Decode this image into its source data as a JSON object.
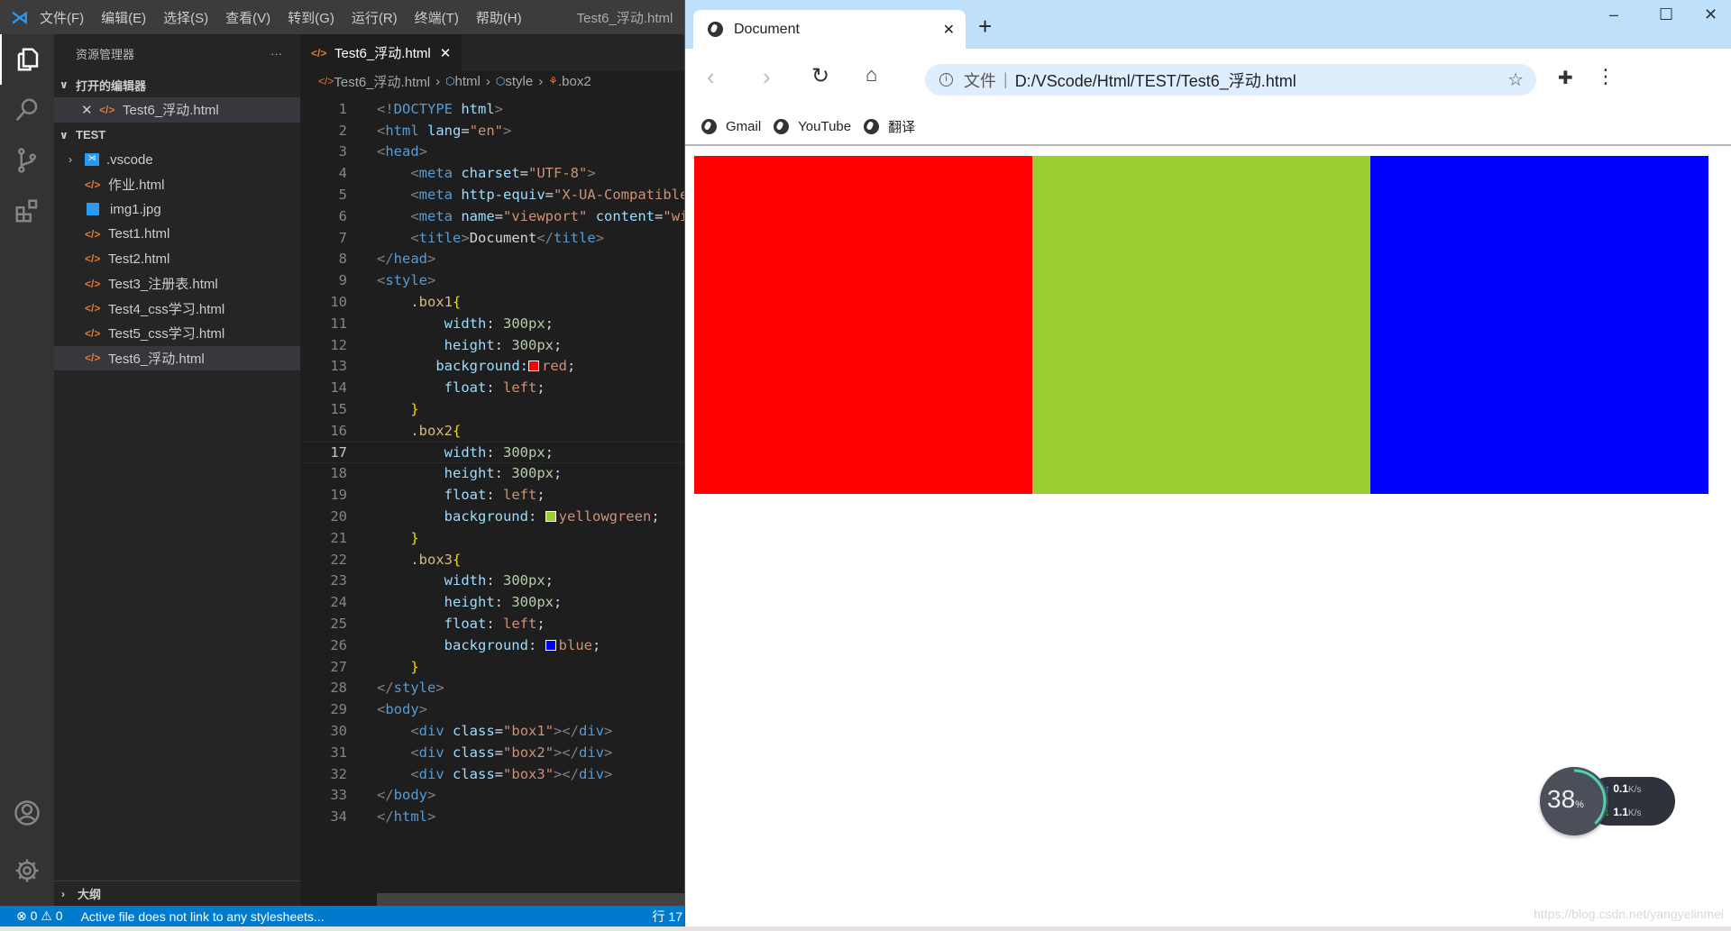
{
  "vscode": {
    "menu": [
      "文件(F)",
      "编辑(E)",
      "选择(S)",
      "查看(V)",
      "转到(G)",
      "运行(R)",
      "终端(T)",
      "帮助(H)"
    ],
    "window_title": "Test6_浮动.html",
    "sidebar": {
      "title": "资源管理器",
      "more": "···",
      "open_editors_label": "打开的编辑器",
      "open_editors": [
        {
          "name": "Test6_浮动.html",
          "close": "✕"
        }
      ],
      "folder_label": "TEST",
      "files": [
        {
          "name": ".vscode",
          "type": "folder"
        },
        {
          "name": "作业.html",
          "type": "html"
        },
        {
          "name": "img1.jpg",
          "type": "image"
        },
        {
          "name": "Test1.html",
          "type": "html"
        },
        {
          "name": "Test2.html",
          "type": "html"
        },
        {
          "name": "Test3_注册表.html",
          "type": "html"
        },
        {
          "name": "Test4_css学习.html",
          "type": "html"
        },
        {
          "name": "Test5_css学习.html",
          "type": "html"
        },
        {
          "name": "Test6_浮动.html",
          "type": "html",
          "selected": true
        }
      ],
      "outline_label": "大纲"
    },
    "tab": {
      "label": "Test6_浮动.html",
      "close": "✕"
    },
    "breadcrumb": [
      "Test6_浮动.html",
      "html",
      "style",
      ".box2"
    ],
    "current_line": 17,
    "code": [
      [
        [
          "p",
          "<!"
        ],
        [
          "tag",
          "DOCTYPE"
        ],
        [
          "txt",
          " "
        ],
        [
          "at",
          "html"
        ],
        [
          "p",
          ">"
        ]
      ],
      [
        [
          "p",
          "<"
        ],
        [
          "tag",
          "html"
        ],
        [
          "txt",
          " "
        ],
        [
          "at",
          "lang"
        ],
        [
          "txt",
          "="
        ],
        [
          "s",
          "\"en\""
        ],
        [
          "p",
          ">"
        ]
      ],
      [
        [
          "p",
          "<"
        ],
        [
          "tag",
          "head"
        ],
        [
          "p",
          ">"
        ]
      ],
      [
        [
          "txt",
          "    "
        ],
        [
          "p",
          "<"
        ],
        [
          "tag",
          "meta"
        ],
        [
          "txt",
          " "
        ],
        [
          "at",
          "charset"
        ],
        [
          "txt",
          "="
        ],
        [
          "s",
          "\"UTF-8\""
        ],
        [
          "p",
          ">"
        ]
      ],
      [
        [
          "txt",
          "    "
        ],
        [
          "p",
          "<"
        ],
        [
          "tag",
          "meta"
        ],
        [
          "txt",
          " "
        ],
        [
          "at",
          "http-equiv"
        ],
        [
          "txt",
          "="
        ],
        [
          "s",
          "\"X-UA-Compatible\""
        ]
      ],
      [
        [
          "txt",
          "    "
        ],
        [
          "p",
          "<"
        ],
        [
          "tag",
          "meta"
        ],
        [
          "txt",
          " "
        ],
        [
          "at",
          "name"
        ],
        [
          "txt",
          "="
        ],
        [
          "s",
          "\"viewport\""
        ],
        [
          "txt",
          " "
        ],
        [
          "at",
          "content"
        ],
        [
          "txt",
          "="
        ],
        [
          "s",
          "\"width"
        ]
      ],
      [
        [
          "txt",
          "    "
        ],
        [
          "p",
          "<"
        ],
        [
          "tag",
          "title"
        ],
        [
          "p",
          ">"
        ],
        [
          "txt",
          "Document"
        ],
        [
          "p",
          "</"
        ],
        [
          "tag",
          "title"
        ],
        [
          "p",
          ">"
        ]
      ],
      [
        [
          "p",
          "</"
        ],
        [
          "tag",
          "head"
        ],
        [
          "p",
          ">"
        ]
      ],
      [
        [
          "p",
          "<"
        ],
        [
          "tag",
          "style"
        ],
        [
          "p",
          ">"
        ]
      ],
      [
        [
          "txt",
          "    "
        ],
        [
          "sel",
          ".box1"
        ],
        [
          "b",
          "{"
        ]
      ],
      [
        [
          "txt",
          "        "
        ],
        [
          "prop",
          "width"
        ],
        [
          "txt",
          ": "
        ],
        [
          "num",
          "300px"
        ],
        [
          "txt",
          ";"
        ]
      ],
      [
        [
          "txt",
          "        "
        ],
        [
          "prop",
          "height"
        ],
        [
          "txt",
          ": "
        ],
        [
          "num",
          "300px"
        ],
        [
          "txt",
          ";"
        ]
      ],
      [
        [
          "txt",
          "       "
        ],
        [
          "prop",
          "background"
        ],
        [
          "txt",
          ":"
        ],
        [
          "swatch",
          "#ff0000"
        ],
        [
          "val",
          "red"
        ],
        [
          "txt",
          ";"
        ]
      ],
      [
        [
          "txt",
          "        "
        ],
        [
          "prop",
          "float"
        ],
        [
          "txt",
          ": "
        ],
        [
          "val",
          "left"
        ],
        [
          "txt",
          ";"
        ]
      ],
      [
        [
          "txt",
          "    "
        ],
        [
          "b",
          "}"
        ]
      ],
      [
        [
          "txt",
          "    "
        ],
        [
          "sel",
          ".box2"
        ],
        [
          "b",
          "{"
        ]
      ],
      [
        [
          "txt",
          "        "
        ],
        [
          "prop",
          "width"
        ],
        [
          "txt",
          ": "
        ],
        [
          "num",
          "300px"
        ],
        [
          "txt",
          ";"
        ]
      ],
      [
        [
          "txt",
          "        "
        ],
        [
          "prop",
          "height"
        ],
        [
          "txt",
          ": "
        ],
        [
          "num",
          "300px"
        ],
        [
          "txt",
          ";"
        ]
      ],
      [
        [
          "txt",
          "        "
        ],
        [
          "prop",
          "float"
        ],
        [
          "txt",
          ": "
        ],
        [
          "val",
          "left"
        ],
        [
          "txt",
          ";"
        ]
      ],
      [
        [
          "txt",
          "        "
        ],
        [
          "prop",
          "background"
        ],
        [
          "txt",
          ": "
        ],
        [
          "swatch",
          "#9acd32"
        ],
        [
          "val",
          "yellowgreen"
        ],
        [
          "txt",
          ";"
        ]
      ],
      [
        [
          "txt",
          "    "
        ],
        [
          "b",
          "}"
        ]
      ],
      [
        [
          "txt",
          "    "
        ],
        [
          "sel",
          ".box3"
        ],
        [
          "b",
          "{"
        ]
      ],
      [
        [
          "txt",
          "        "
        ],
        [
          "prop",
          "width"
        ],
        [
          "txt",
          ": "
        ],
        [
          "num",
          "300px"
        ],
        [
          "txt",
          ";"
        ]
      ],
      [
        [
          "txt",
          "        "
        ],
        [
          "prop",
          "height"
        ],
        [
          "txt",
          ": "
        ],
        [
          "num",
          "300px"
        ],
        [
          "txt",
          ";"
        ]
      ],
      [
        [
          "txt",
          "        "
        ],
        [
          "prop",
          "float"
        ],
        [
          "txt",
          ": "
        ],
        [
          "val",
          "left"
        ],
        [
          "txt",
          ";"
        ]
      ],
      [
        [
          "txt",
          "        "
        ],
        [
          "prop",
          "background"
        ],
        [
          "txt",
          ": "
        ],
        [
          "swatch",
          "#0000ff"
        ],
        [
          "val",
          "blue"
        ],
        [
          "txt",
          ";"
        ]
      ],
      [
        [
          "txt",
          "    "
        ],
        [
          "b",
          "}"
        ]
      ],
      [
        [
          "p",
          "</"
        ],
        [
          "tag",
          "style"
        ],
        [
          "p",
          ">"
        ]
      ],
      [
        [
          "p",
          "<"
        ],
        [
          "tag",
          "body"
        ],
        [
          "p",
          ">"
        ]
      ],
      [
        [
          "txt",
          "    "
        ],
        [
          "p",
          "<"
        ],
        [
          "tag",
          "div"
        ],
        [
          "txt",
          " "
        ],
        [
          "at",
          "class"
        ],
        [
          "txt",
          "="
        ],
        [
          "s",
          "\"box1\""
        ],
        [
          "p",
          "></"
        ],
        [
          "tag",
          "div"
        ],
        [
          "p",
          ">"
        ]
      ],
      [
        [
          "txt",
          "    "
        ],
        [
          "p",
          "<"
        ],
        [
          "tag",
          "div"
        ],
        [
          "txt",
          " "
        ],
        [
          "at",
          "class"
        ],
        [
          "txt",
          "="
        ],
        [
          "s",
          "\"box2\""
        ],
        [
          "p",
          "></"
        ],
        [
          "tag",
          "div"
        ],
        [
          "p",
          ">"
        ]
      ],
      [
        [
          "txt",
          "    "
        ],
        [
          "p",
          "<"
        ],
        [
          "tag",
          "div"
        ],
        [
          "txt",
          " "
        ],
        [
          "at",
          "class"
        ],
        [
          "txt",
          "="
        ],
        [
          "s",
          "\"box3\""
        ],
        [
          "p",
          "></"
        ],
        [
          "tag",
          "div"
        ],
        [
          "p",
          ">"
        ]
      ],
      [
        [
          "p",
          "</"
        ],
        [
          "tag",
          "body"
        ],
        [
          "p",
          ">"
        ]
      ],
      [
        [
          "p",
          "</"
        ],
        [
          "tag",
          "html"
        ],
        [
          "p",
          ">"
        ]
      ]
    ],
    "status": {
      "errors": "0",
      "warnings": "0",
      "message": "Active file does not link to any stylesheets...",
      "position": "行 17"
    }
  },
  "browser": {
    "tab_title": "Document",
    "tab_close": "✕",
    "new_tab": "+",
    "window_controls": {
      "minimize": "–",
      "maximize": "☐",
      "close": "✕"
    },
    "address": {
      "scheme_label": "文件",
      "url": "D:/VScode/Html/TEST/Test6_浮动.html"
    },
    "bookmarks": [
      "Gmail",
      "YouTube",
      "翻译"
    ],
    "boxes": [
      {
        "class": "box1",
        "color": "#ff0000"
      },
      {
        "class": "box2",
        "color": "#9acd32"
      },
      {
        "class": "box3",
        "color": "#0000ff"
      }
    ]
  },
  "widget": {
    "cpu_percent": "38",
    "percent_sign": "%",
    "upload": "0.1",
    "download": "1.1",
    "unit": "K/s"
  },
  "watermark": "https://blog.csdn.net/yangyelinmei"
}
